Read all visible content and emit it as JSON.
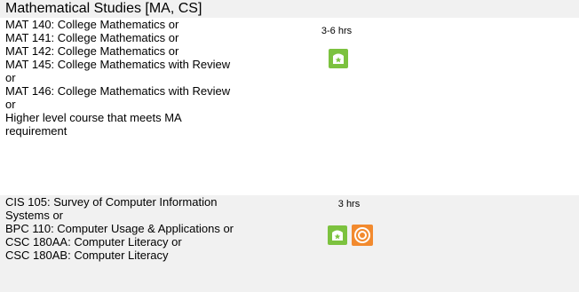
{
  "section": {
    "title": "Mathematical Studies [MA, CS]"
  },
  "rows": [
    {
      "lines": [
        "MAT 140: College Mathematics or",
        "MAT 141: College Mathematics or",
        "MAT 142: College Mathematics or",
        "MAT 145: College Mathematics with Review",
        "or",
        "MAT 146: College Mathematics with Review",
        "or",
        "Higher level course that meets MA",
        "requirement"
      ],
      "hours": "3-6 hrs",
      "icons": [
        "green-book-icon"
      ]
    },
    {
      "lines": [
        "CIS 105: Survey of Computer Information",
        "Systems or",
        "BPC 110: Computer Usage & Applications or",
        "CSC 180AA: Computer Literacy or",
        "CSC 180AB: Computer Literacy"
      ],
      "hours": "3 hrs",
      "icons": [
        "green-book-icon",
        "orange-target-icon"
      ]
    }
  ],
  "colors": {
    "row_alt_bg": "#f1f1f1",
    "green_icon": "#7cc23f",
    "orange_icon": "#f28a2e"
  }
}
